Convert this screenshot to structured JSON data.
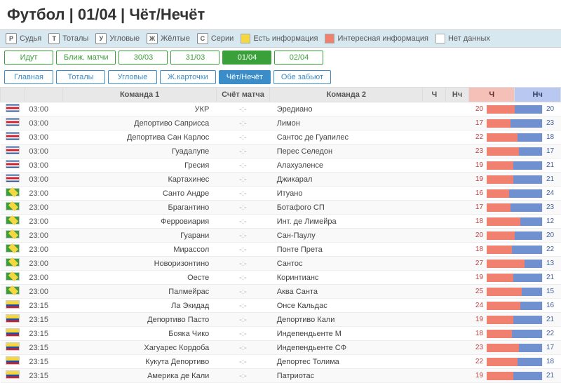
{
  "title": "Футбол | 01/04 | Чёт/Нечёт",
  "legend": {
    "ref": "Судья",
    "totals": "Тоталы",
    "corners": "Угловые",
    "yellow": "Жёлтые",
    "series": "Серии",
    "info_yes": "Есть информация",
    "info_int": "Интересная информация",
    "no_data": "Нет данных",
    "icon_ref": "Р",
    "icon_tot": "Т",
    "icon_cor": "У",
    "icon_yel": "Ж",
    "icon_ser": "С"
  },
  "date_tabs": {
    "live": "Идут",
    "near": "Ближ. матчи",
    "d1": "30/03",
    "d2": "31/03",
    "d3": "01/04",
    "d4": "02/04"
  },
  "view_tabs": {
    "main": "Главная",
    "totals": "Тоталы",
    "corners": "Угловые",
    "cards": "Ж.карточки",
    "oe": "Чёт/Нечёт",
    "both": "Обе забьют"
  },
  "columns": {
    "team1": "Команда 1",
    "score": "Счёт матча",
    "team2": "Команда 2",
    "ch": "Ч",
    "nch": "Нч"
  },
  "matches": [
    {
      "flag": "cr",
      "time": "03:00",
      "t1": "УКР",
      "score": "-:-",
      "t2": "Эредиано",
      "odd": 20,
      "even": 20
    },
    {
      "flag": "cr",
      "time": "03:00",
      "t1": "Депортиво Саприсса",
      "score": "-:-",
      "t2": "Лимон",
      "odd": 17,
      "even": 23
    },
    {
      "flag": "cr",
      "time": "03:00",
      "t1": "Депортива Сан Карлос",
      "score": "-:-",
      "t2": "Сантос де Гуапилес",
      "odd": 22,
      "even": 18
    },
    {
      "flag": "cr",
      "time": "03:00",
      "t1": "Гуадалупе",
      "score": "-:-",
      "t2": "Перес Селедон",
      "odd": 23,
      "even": 17
    },
    {
      "flag": "cr",
      "time": "03:00",
      "t1": "Гресия",
      "score": "-:-",
      "t2": "Алахуэленсе",
      "odd": 19,
      "even": 21
    },
    {
      "flag": "cr",
      "time": "03:00",
      "t1": "Картахинес",
      "score": "-:-",
      "t2": "Джикарал",
      "odd": 19,
      "even": 21
    },
    {
      "flag": "br",
      "time": "23:00",
      "t1": "Санто Андре",
      "score": "-:-",
      "t2": "Итуано",
      "odd": 16,
      "even": 24
    },
    {
      "flag": "br",
      "time": "23:00",
      "t1": "Брагантино",
      "score": "-:-",
      "t2": "Ботафого СП",
      "odd": 17,
      "even": 23
    },
    {
      "flag": "br",
      "time": "23:00",
      "t1": "Ферровиария",
      "score": "-:-",
      "t2": "Инт. де Лимейра",
      "odd": 18,
      "even": 12
    },
    {
      "flag": "br",
      "time": "23:00",
      "t1": "Гуарани",
      "score": "-:-",
      "t2": "Сан-Паулу",
      "odd": 20,
      "even": 20
    },
    {
      "flag": "br",
      "time": "23:00",
      "t1": "Мирассол",
      "score": "-:-",
      "t2": "Понте Прета",
      "odd": 18,
      "even": 22
    },
    {
      "flag": "br",
      "time": "23:00",
      "t1": "Новоризонтино",
      "score": "-:-",
      "t2": "Сантос",
      "odd": 27,
      "even": 13
    },
    {
      "flag": "br",
      "time": "23:00",
      "t1": "Оесте",
      "score": "-:-",
      "t2": "Коринтианс",
      "odd": 19,
      "even": 21
    },
    {
      "flag": "br",
      "time": "23:00",
      "t1": "Палмейрас",
      "score": "-:-",
      "t2": "Аква Санта",
      "odd": 25,
      "even": 15
    },
    {
      "flag": "co",
      "time": "23:15",
      "t1": "Ла Экидад",
      "score": "-:-",
      "t2": "Онсе Кальдас",
      "odd": 24,
      "even": 16
    },
    {
      "flag": "co",
      "time": "23:15",
      "t1": "Депортиво Пасто",
      "score": "-:-",
      "t2": "Депортиво Кали",
      "odd": 19,
      "even": 21
    },
    {
      "flag": "co",
      "time": "23:15",
      "t1": "Бояка Чико",
      "score": "-:-",
      "t2": "Индепендьенте М",
      "odd": 18,
      "even": 22
    },
    {
      "flag": "co",
      "time": "23:15",
      "t1": "Хагуарес Кордоба",
      "score": "-:-",
      "t2": "Индепендьенте СФ",
      "odd": 23,
      "even": 17
    },
    {
      "flag": "co",
      "time": "23:15",
      "t1": "Кукута Депортиво",
      "score": "-:-",
      "t2": "Депортес Толима",
      "odd": 22,
      "even": 18
    },
    {
      "flag": "co",
      "time": "23:15",
      "t1": "Америка де Кали",
      "score": "-:-",
      "t2": "Патриотас",
      "odd": 19,
      "even": 21
    }
  ]
}
